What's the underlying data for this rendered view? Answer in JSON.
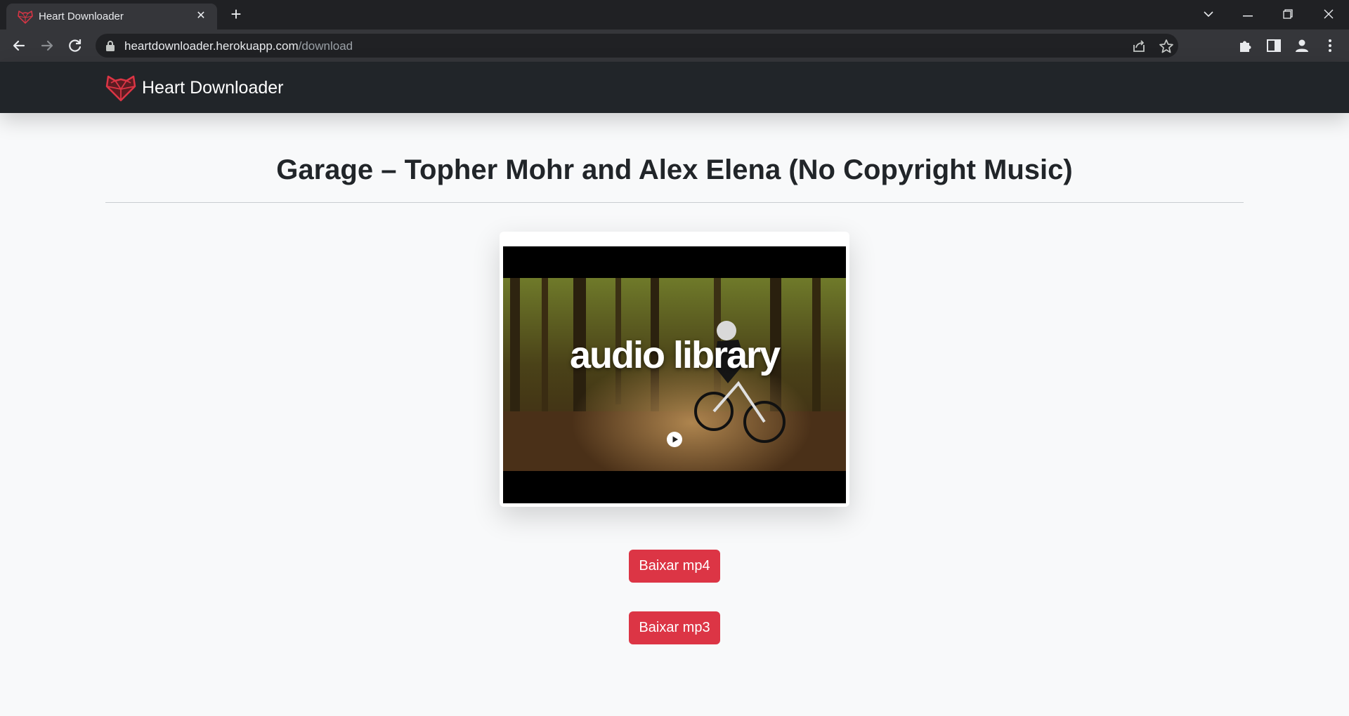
{
  "browser": {
    "tab_title": "Heart Downloader",
    "tab_close": "✕",
    "new_tab": "+",
    "url_host": "heartdownloader.herokuapp.com",
    "url_path": "/download",
    "window_controls": {
      "chevron": "⌄",
      "minimize": "—",
      "restore": "❐",
      "close": "✕"
    }
  },
  "navbar": {
    "brand_name": "Heart Downloader",
    "brand_color": "#dc3545"
  },
  "main": {
    "video_title": "Garage – Topher Mohr and Alex Elena (No Copyright Music)",
    "thumbnail_overlay": "audio library",
    "buttons": {
      "mp4": "Baixar mp4",
      "mp3": "Baixar mp3"
    }
  },
  "icons": [
    "heart-fox-logo-icon",
    "close-icon",
    "plus-icon",
    "back-arrow-icon",
    "forward-arrow-icon",
    "reload-icon",
    "lock-icon",
    "share-icon",
    "star-icon",
    "puzzle-icon",
    "side-panel-icon",
    "profile-icon",
    "kebab-menu-icon",
    "play-icon"
  ],
  "colors": {
    "accent": "#dc3545",
    "navbar": "#212529",
    "page_bg": "#f8f9fa"
  }
}
